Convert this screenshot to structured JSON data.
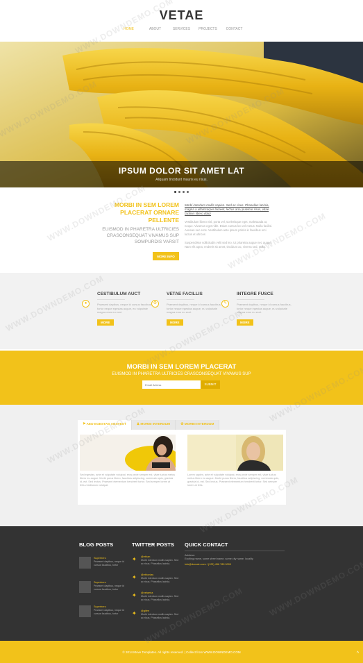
{
  "header": {
    "logo": "VETAE",
    "nav": [
      "HOME",
      "ABOUT",
      "SERVICES",
      "PROJECTS",
      "CONTACT"
    ],
    "active_index": 0
  },
  "hero": {
    "title": "IPSUM DOLOR SIT AMET LAT",
    "subtitle": "Aliquam tincidunt mauris eu risus.",
    "slide_count": 4,
    "active_slide": 0
  },
  "intro": {
    "heading": "MORBI IN SEM LOREM PLACERAT ORNARE PELLENTE",
    "subheading": "EUISMOD IN PHARETRA ULTRICIES CRASCONSEQUAT VIVAMUS SUP SOMPURDIS VARSIT",
    "button": "MORE INFO",
    "link_text": "Morbi interdum mollis sapien. Sed ac risus. Phasellus lacinia, magna a ullamcorper laoreet, lectus arcu pulvinar risus, vitae facilisis libero dolor",
    "p1": "Vestibulum libero nisl, porta vel, scelerisque eget, malesuada at, neque. Vivamus eget nibh. Etiam cursus leo vel metus. Nulla facilisi. Aenean nec eros. Vestibulum ante ipsum primis in faucibus orci luctus et ultrices",
    "p2": "Suspendisse sollicitudin velit sed leo. Ut pharetra augue nec augue. Nam elit agna, endrerit sit amet, tincidunt ac, viverra sed, nulla."
  },
  "features": [
    {
      "title": "CESTIBULUM AUCT",
      "icon": "person-icon",
      "text": "Praesent dapibus, neque id cursus faucibus, tortor neque egestas augue, eu vulputate magna eros eu erat.",
      "button": "MORE"
    },
    {
      "title": "VETAE FACILLIS",
      "icon": "gear-icon",
      "text": "Praesent dapibus, neque id cursus faucibus, tortor neque egestas augue, eu vulputate magna eros eu erat.",
      "button": "MORE"
    },
    {
      "title": "INTEGRE FUSCE",
      "icon": "pencil-icon",
      "text": "Praesent dapibus, neque id cursus faucibus, tortor neque egestas augue, eu vulputate magna eros eu erat.",
      "button": "MORE"
    }
  ],
  "yellow_band": {
    "title": "MORBI IN SEM LOREM PLACERAT",
    "subtitle": "EUISMOD IN PHARETRA ULTRICIES CRASCONSEQUAT VIVAMUS SUP",
    "input_placeholder": "Email Adress",
    "submit": "SUBMIT"
  },
  "tabs": {
    "items": [
      "AED EGESTAS AESTEST",
      "MORBI INTERDUM",
      "MORBI INTERDUM"
    ],
    "active_index": 0,
    "captions": [
      "Sed egestas, ante et vulputate volutpat, eros pede semper est, vitae luctus metus libero eu augue. Morbi purus libero, faucibus adipiscing, commodo quis, gravida id, est. Sed lectus. Praesent elementum hendrerit tortor. Sed semper lorem at felis vestibulum volutpat.",
      "Lorem sapien, ante et vulputate volutpat, eros pede semper est, vitae luctus metus libero eu augue. Morbi purus libero, faucibus adipiscing, commodo quis, gravida id, est. Sed lectus. Praesent elementum hendrerit tortor. Sed semper lorem at felis."
    ]
  },
  "footer": {
    "blog_heading": "BLOG POSTS",
    "twitter_heading": "TWITTER POSTS",
    "contact_heading": "QUICK CONTACT",
    "blog_posts": [
      {
        "author": "Superhero",
        "date": "June Kee",
        "text": "Praesent dapibus, neque id cursus faucibus, tortor"
      },
      {
        "author": "Superhero",
        "date": "June Kee",
        "text": "Praesent dapibus, neque id cursus faucibus, tortor"
      },
      {
        "author": "Superhero",
        "date": "June Kee",
        "text": "Praesent dapibus, neque id cursus faucibus, tortor"
      }
    ],
    "tweets": [
      {
        "handle": "@ethan",
        "text": "Morbi interdum mollis sapien. Sed ac risus. Phasellus lacinia."
      },
      {
        "handle": "@ethonias",
        "text": "Morbi interdum mollis sapien. Sed ac risus. Phasellus lacinia."
      },
      {
        "handle": "@vetaeria",
        "text": "Morbi interdum mollis sapien. Sed ac risus. Phasellus lacinia."
      },
      {
        "handle": "@gifee",
        "text": "Morbi interdum mollis sapien. Sed ac risus. Phasellus lacinia."
      }
    ],
    "contact_address_label": "Address:",
    "contact_address": "Exciting name, some street name, some city name, locality",
    "contact_email": "info@domain.com / (123) 456 789 0000"
  },
  "bottom": {
    "copyright": "© 2014 Move Templates. All rights reserved. | Collect from WWW.DOWNDEMO.COM",
    "to_top": "^"
  },
  "watermark": "WWW.DOWNDEMO.COM",
  "colors": {
    "accent": "#f2c21a",
    "dark": "#333333",
    "light_bg": "#f2f2f2"
  }
}
